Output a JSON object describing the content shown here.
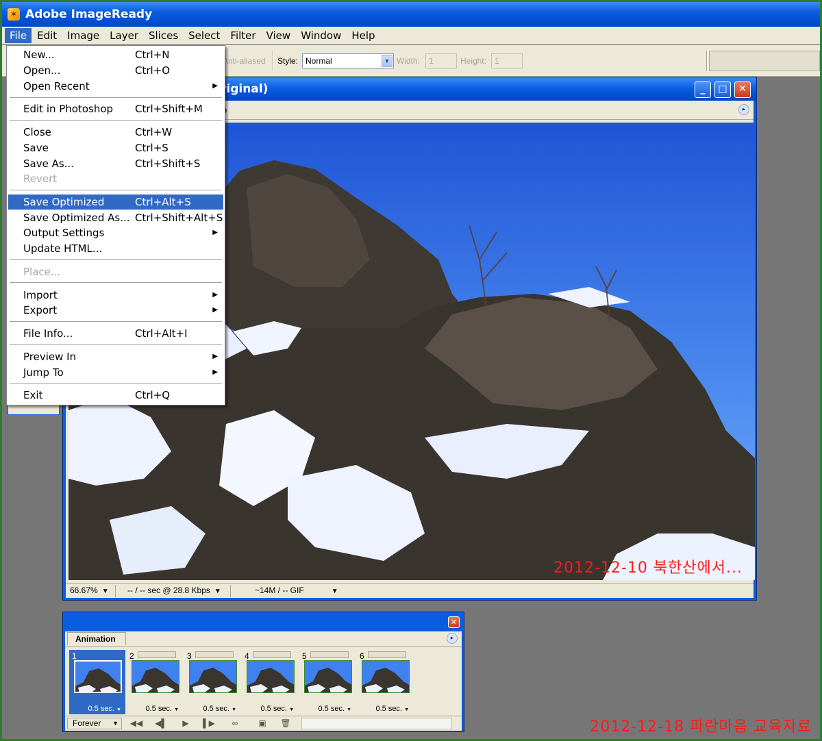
{
  "app": {
    "title": "Adobe ImageReady"
  },
  "menubar": [
    {
      "label": "File",
      "active": true
    },
    {
      "label": "Edit"
    },
    {
      "label": "Image"
    },
    {
      "label": "Layer"
    },
    {
      "label": "Slices"
    },
    {
      "label": "Select"
    },
    {
      "label": "Filter"
    },
    {
      "label": "View"
    },
    {
      "label": "Window"
    },
    {
      "label": "Help"
    }
  ],
  "options_bar": {
    "anti_aliased": "Anti-aliased",
    "style_label": "Style:",
    "style_value": "Normal",
    "width_label": "Width:",
    "width_value": "1",
    "height_label": "Height:",
    "height_value": "1"
  },
  "file_menu": {
    "items": [
      {
        "label": "New...",
        "shortcut": "Ctrl+N"
      },
      {
        "label": "Open...",
        "shortcut": "Ctrl+O"
      },
      {
        "label": "Open Recent",
        "shortcut": "",
        "submenu": true
      },
      {
        "label": "Edit in Photoshop",
        "shortcut": "Ctrl+Shift+M"
      },
      {
        "label": "Close",
        "shortcut": "Ctrl+W"
      },
      {
        "label": "Save",
        "shortcut": "Ctrl+S"
      },
      {
        "label": "Save As...",
        "shortcut": "Ctrl+Shift+S"
      },
      {
        "label": "Revert",
        "shortcut": "",
        "disabled": true
      },
      {
        "label": "Save Optimized",
        "shortcut": "Ctrl+Alt+S",
        "highlighted": true
      },
      {
        "label": "Save Optimized As...",
        "shortcut": "Ctrl+Shift+Alt+S"
      },
      {
        "label": "Output Settings",
        "shortcut": "",
        "submenu": true
      },
      {
        "label": "Update HTML...",
        "shortcut": ""
      },
      {
        "label": "Place...",
        "shortcut": "",
        "disabled": true
      },
      {
        "label": "Import",
        "shortcut": "",
        "submenu": true
      },
      {
        "label": "Export",
        "shortcut": "",
        "submenu": true
      },
      {
        "label": "File Info...",
        "shortcut": "Ctrl+Alt+I"
      },
      {
        "label": "Preview In",
        "shortcut": "",
        "submenu": true
      },
      {
        "label": "Jump To",
        "shortcut": "",
        "submenu": true
      },
      {
        "label": "Exit",
        "shortcut": "Ctrl+Q"
      }
    ]
  },
  "document": {
    "title_fragment": "riginal)",
    "tab_fragment": "p",
    "watermark": "2012-12-10 북한산에서...",
    "status": {
      "zoom": "66.67%",
      "download": "-- / -- sec @ 28.8 Kbps",
      "size": "~14M / -- GIF"
    }
  },
  "animation": {
    "tab": "Animation",
    "loop": "Forever",
    "frames": [
      {
        "number": "1",
        "delay": "0.5 sec.",
        "selected": true
      },
      {
        "number": "2",
        "delay": "0.5 sec."
      },
      {
        "number": "3",
        "delay": "0.5 sec."
      },
      {
        "number": "4",
        "delay": "0.5 sec."
      },
      {
        "number": "5",
        "delay": "0.5 sec."
      },
      {
        "number": "6",
        "delay": "0.5 sec."
      }
    ]
  },
  "footer_watermark": "2012-12-18 파란마음 교육자료",
  "icons": {
    "app_logo": "imageready-logo-icon",
    "minimize": "minimize-icon",
    "maximize": "maximize-icon",
    "close": "close-icon",
    "submenu": "chevron-right-icon",
    "dropdown": "chevron-down-icon"
  },
  "colors": {
    "title_blue": "#0a5ce0",
    "menu_highlight": "#316ac5",
    "watermark_red": "#ff1a1a",
    "frame_border": "#2e7d32"
  }
}
